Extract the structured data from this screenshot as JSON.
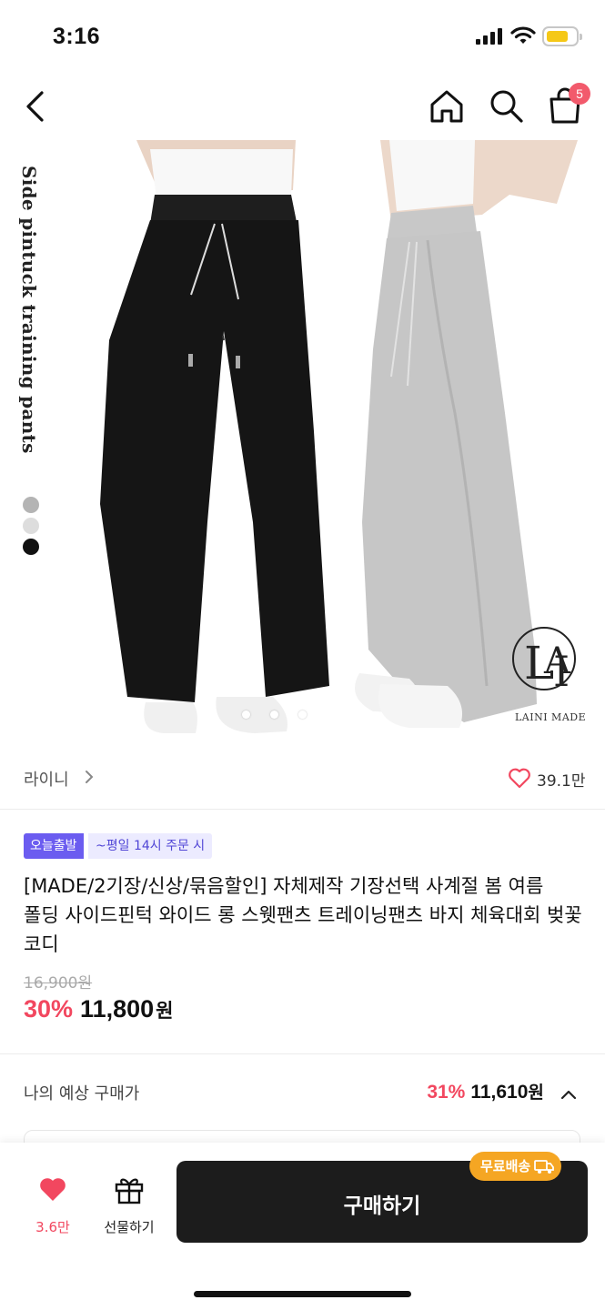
{
  "status_bar": {
    "time": "3:16"
  },
  "nav": {
    "cart_count": "5"
  },
  "product_image": {
    "side_text": "Side pintuck training pants",
    "swatch_colors": [
      "#b4b4b4",
      "#dddddd",
      "#111111"
    ],
    "brand_logo_text": "LAINI MADE"
  },
  "shop": {
    "name": "라이니",
    "likes": "39.1만"
  },
  "product": {
    "badge_main": "오늘출발",
    "badge_sub": "~평일 14시 주문 시",
    "title": "[MADE/2기장/신상/묶음할인] 자체제작 기장선택 사계절 봄 여름 폴딩 사이드핀턱 와이드 롱 스웻팬츠 트레이닝팬츠 바지 체육대회 벚꽃 코디",
    "original_price": "16,900원",
    "discount": "30%",
    "price": "11,800",
    "currency": "원"
  },
  "expected": {
    "label": "나의 예상 구매가",
    "discount": "31%",
    "price": "11,610",
    "currency": "원"
  },
  "bottom_bar": {
    "wish_count": "3.6만",
    "gift_label": "선물하기",
    "buy_label": "구매하기",
    "shipping_badge": "무료배송"
  },
  "colors": {
    "accent": "#f2475f",
    "badge": "#6b5cf0",
    "shipping": "#f5a623"
  }
}
